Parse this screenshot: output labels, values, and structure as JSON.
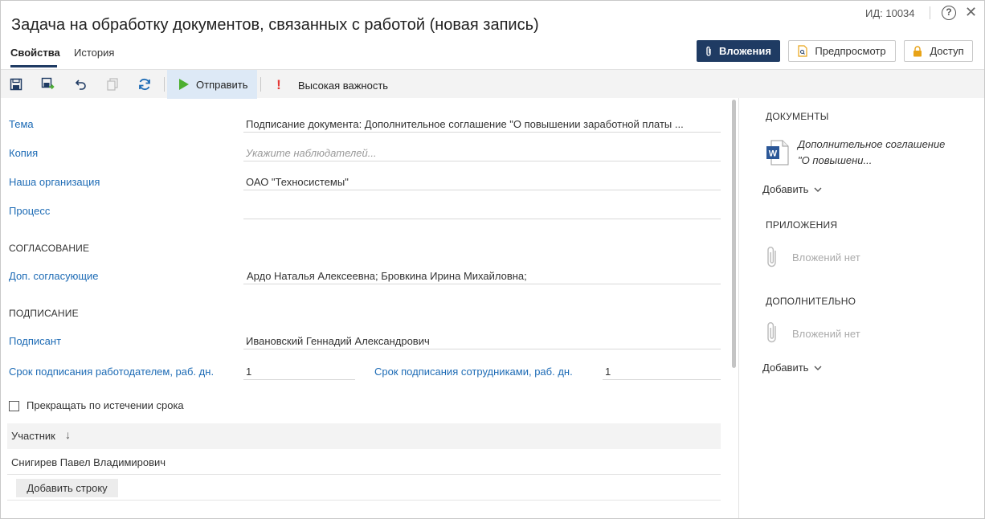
{
  "header": {
    "title": "Задача на обработку документов, связанных с работой (новая запись)",
    "id_label": "ИД: 10034",
    "help_glyph": "?",
    "close_glyph": "✕",
    "tabs": [
      {
        "label": "Свойства",
        "active": true
      },
      {
        "label": "История",
        "active": false
      }
    ],
    "buttons": {
      "attachments": "Вложения",
      "preview": "Предпросмотр",
      "access": "Доступ"
    }
  },
  "toolbar": {
    "icons": [
      "save-icon",
      "save-and-close-icon",
      "undo-icon",
      "copy-icon",
      "refresh-icon"
    ],
    "send_label": "Отправить",
    "priority_glyph": "!",
    "priority_label": "Высокая важность",
    "send_color": "#4caf30",
    "priority_color": "#e53935"
  },
  "form": {
    "subject": {
      "label": "Тема",
      "value": "Подписание документа: Дополнительное соглашение \"О повышении заработной платы ..."
    },
    "copy": {
      "label": "Копия",
      "placeholder": "Укажите наблюдателей..."
    },
    "organization": {
      "label": "Наша организация",
      "value": "ОАО \"Техносистемы\""
    },
    "process": {
      "label": "Процесс",
      "value": ""
    },
    "approval_section": "СОГЛАСОВАНИЕ",
    "approvers": {
      "label": "Доп. согласующие",
      "value": "Ардо Наталья Алексеевна;  Бровкина Ирина Михайловна;"
    },
    "signing_section": "ПОДПИСАНИЕ",
    "signer": {
      "label": "Подписант",
      "value": "Ивановский Геннадий Александрович"
    },
    "employer_deadline": {
      "label": "Срок подписания работодателем, раб. дн.",
      "value": "1"
    },
    "employee_deadline": {
      "label": "Срок подписания сотрудниками, раб. дн.",
      "value": "1"
    },
    "stop_on_expiry": {
      "label": "Прекращать по истечении срока",
      "checked": false
    },
    "participants": {
      "column_header": "Участник",
      "sort_glyph": "↓",
      "rows": [
        "Снигирев Павел Владимирович"
      ],
      "add_row_label": "Добавить строку"
    }
  },
  "right_panel": {
    "documents_title": "ДОКУМЕНТЫ",
    "document_name": "Дополнительное соглашение \"О повышени...",
    "doc_icon_letter": "W",
    "add_label_1": "Добавить",
    "attachments_title": "ПРИЛОЖЕНИЯ",
    "attachments_empty": "Вложений нет",
    "additional_title": "ДОПОЛНИТЕЛЬНО",
    "additional_empty": "Вложений нет",
    "add_label_2": "Добавить"
  },
  "colors": {
    "accent": "#1f3b63",
    "link": "#1d6bb5",
    "toolbar_bg": "#f3f3f3",
    "send_highlight": "#dde9f6",
    "word_blue": "#2b5797",
    "lock_yellow": "#e8a317"
  }
}
